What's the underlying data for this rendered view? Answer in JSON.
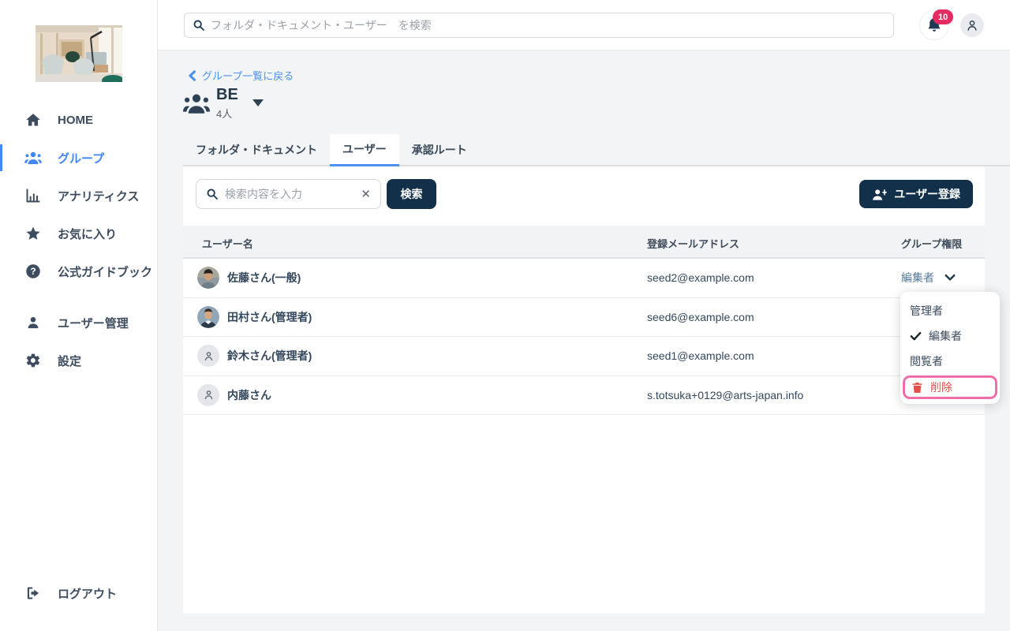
{
  "sidebar": {
    "logo": "office-lounge-photo",
    "items": [
      {
        "label": "HOME",
        "icon": "home-icon",
        "active": false
      },
      {
        "label": "グループ",
        "icon": "users-icon",
        "active": true
      },
      {
        "label": "アナリティクス",
        "icon": "bar-chart-icon",
        "active": false
      },
      {
        "label": "お気に入り",
        "icon": "star-icon",
        "active": false
      },
      {
        "label": "公式ガイドブック",
        "icon": "question-circle-icon",
        "active": false
      },
      {
        "label": "ユーザー管理",
        "icon": "user-icon",
        "active": false
      },
      {
        "label": "設定",
        "icon": "gear-icon",
        "active": false
      }
    ],
    "logout_label": "ログアウト"
  },
  "topbar": {
    "search_placeholder": "フォルダ・ドキュメント・ユーザー　を検索",
    "notification_count": "10"
  },
  "page": {
    "back_link": "グループ一覧に戻る",
    "group_name": "BE",
    "member_count": "4人",
    "tabs": [
      {
        "label": "フォルダ・ドキュメント",
        "active": false
      },
      {
        "label": "ユーザー",
        "active": true
      },
      {
        "label": "承認ルート",
        "active": false
      }
    ],
    "panel": {
      "search_placeholder": "検索内容を入力",
      "search_button": "検索",
      "register_button": "ユーザー登録",
      "table": {
        "headers": [
          "ユーザー名",
          "登録メールアドレス",
          "グループ権限"
        ],
        "rows": [
          {
            "name": "佐藤さん(一般)",
            "email": "seed2@example.com",
            "permission": "編集者",
            "avatar": "photo-man-casual"
          },
          {
            "name": "田村さん(管理者)",
            "email": "seed6@example.com",
            "permission": "",
            "avatar": "photo-man-suit"
          },
          {
            "name": "鈴木さん(管理者)",
            "email": "seed1@example.com",
            "permission": "",
            "avatar": "placeholder-person"
          },
          {
            "name": "内藤さん",
            "email": "s.totsuka+0129@arts-japan.info",
            "permission": "",
            "avatar": "placeholder-person"
          }
        ]
      }
    },
    "permission_menu": {
      "items": [
        {
          "label": "管理者",
          "checked": false
        },
        {
          "label": "編集者",
          "checked": true
        },
        {
          "label": "閲覧者",
          "checked": false
        }
      ],
      "delete_label": "削除"
    }
  },
  "colors": {
    "accent_blue": "#4285f4",
    "link_blue": "#4a90f5",
    "navy_button": "#13304a",
    "badge_pink": "#e52c62",
    "delete_red": "#e25047",
    "highlight_pink": "#f06daa"
  }
}
